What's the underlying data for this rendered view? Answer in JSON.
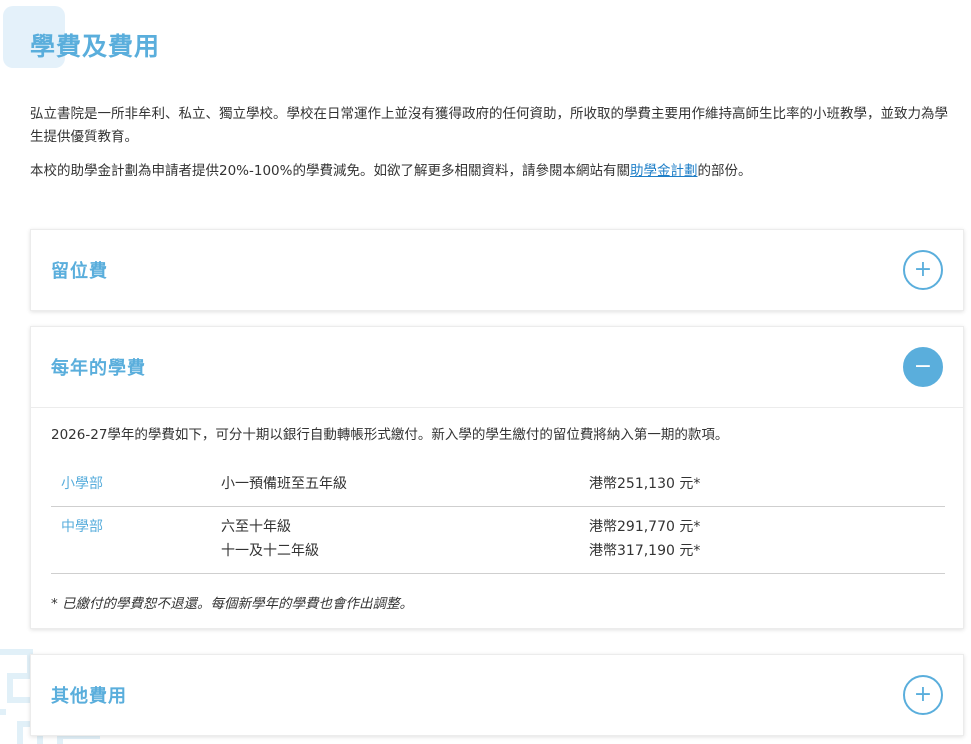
{
  "page_title": "學費及費用",
  "intro": {
    "para1": "弘立書院是一所非牟利、私立、獨立學校。學校在日常運作上並沒有獲得政府的任何資助，所收取的學費主要用作維持高師生比率的小班教學，並致力為學生提供優質教育。",
    "para2_before": "本校的助學金計劃為申請者提供20%-100%的學費減免。如欲了解更多相關資料，請參閱本網站有關",
    "para2_link": "助學金計劃",
    "para2_after": "的部份。"
  },
  "accordion": [
    {
      "title": "留位費",
      "expanded": false,
      "toggle_symbol": "+"
    },
    {
      "title": "每年的學費",
      "expanded": true,
      "toggle_symbol": "−",
      "body": {
        "intro": "2026-27學年的學費如下，可分十期以銀行自動轉帳形式繳付。新入學的學生繳付的留位費將納入第一期的款項。",
        "rows": [
          {
            "section": "小學部",
            "grades": [
              "小一預備班至五年級"
            ],
            "fees": [
              "港幣251,130 元*"
            ]
          },
          {
            "section": "中學部",
            "grades": [
              "六至十年級",
              "十一及十二年級"
            ],
            "fees": [
              "港幣291,770 元*",
              "港幣317,190 元*"
            ]
          }
        ],
        "note": "* 已繳付的學費恕不退還。每個新學年的學費也會作出調整。"
      }
    },
    {
      "title": "其他費用",
      "expanded": false,
      "toggle_symbol": "+"
    }
  ],
  "colors": {
    "accent": "#5aaedc",
    "link": "#1f7fc8",
    "text": "#333333"
  }
}
